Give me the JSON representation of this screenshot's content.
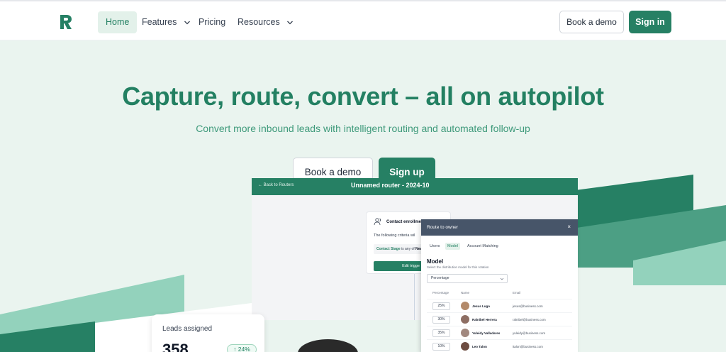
{
  "colors": {
    "brand": "#268064",
    "brand_light": "#e3f1ea",
    "hero_bg": "#eaf4ef"
  },
  "nav": {
    "items": [
      {
        "label": "Home",
        "active": true
      },
      {
        "label": "Features",
        "dropdown": true
      },
      {
        "label": "Pricing"
      },
      {
        "label": "Resources",
        "dropdown": true
      }
    ],
    "book_demo": "Book a demo",
    "sign_in": "Sign in"
  },
  "hero": {
    "title": "Capture, route, convert – all on autopilot",
    "subtitle": "Convert more inbound leads with intelligent routing and automated follow-up",
    "book_demo": "Book a demo",
    "sign_up": "Sign up"
  },
  "mockup": {
    "back": "← Back to Routers",
    "title": "Unnamed router - 2024-10",
    "contact_card": {
      "title": "Contact enrollme",
      "text": "The following criteria wil",
      "row_field": "Contact Stage",
      "row_op": "is any of",
      "row_value": "New",
      "button": "Edit trigge"
    },
    "plus": "+"
  },
  "route_panel": {
    "title": "Route to owner",
    "close": "×",
    "tabs": [
      "Users",
      "Model",
      "Account Matching"
    ],
    "active_tab": "Model",
    "model_title": "Model",
    "model_sub": "Select the distribution model for this rotation",
    "select_value": "Percentage",
    "headers": [
      "Percentage",
      "Name",
      "Email"
    ],
    "rows": [
      {
        "pct": "25%",
        "name": "Jesus Lugo",
        "email": "jesus@business.com",
        "avatar": "#b38a6a"
      },
      {
        "pct": "30%",
        "name": "Ralnibel Herrera",
        "email": "ralnibel@business.com",
        "avatar": "#8d6e63"
      },
      {
        "pct": "35%",
        "name": "Yuleidy Valladares",
        "email": "yuleidy@business.com",
        "avatar": "#a1887f"
      },
      {
        "pct": "10%",
        "name": "Leo Talon",
        "email": "italon@business.com",
        "avatar": "#6d4c41"
      }
    ]
  },
  "leads": {
    "title": "Leads assigned",
    "value": "358",
    "badge": "↑ 24%"
  }
}
